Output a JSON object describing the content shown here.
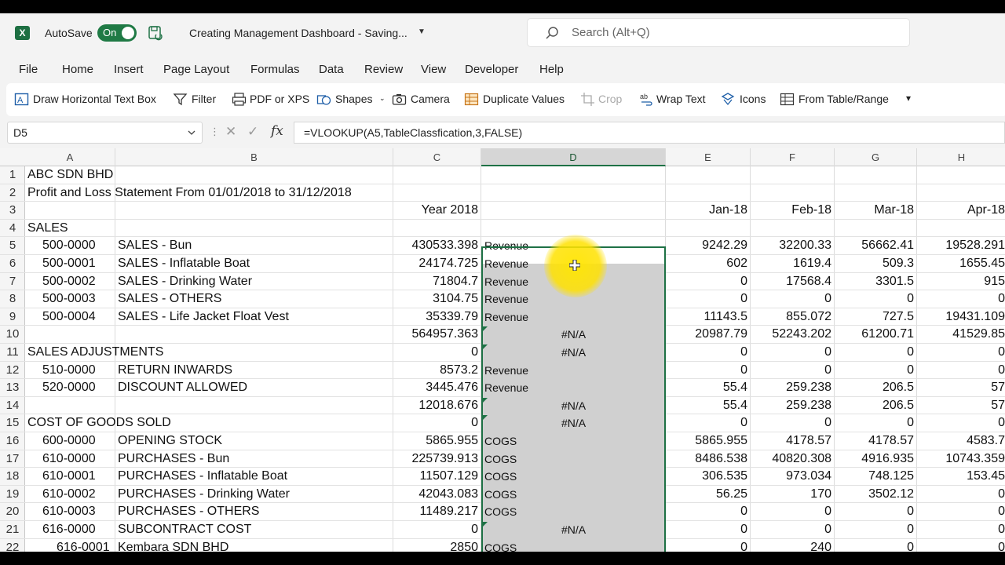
{
  "titlebar": {
    "autosave_label": "AutoSave",
    "toggle_state": "On",
    "document_title": "Creating Management Dashboard  -  Saving...",
    "search_placeholder": "Search (Alt+Q)"
  },
  "menu": [
    "File",
    "Home",
    "Insert",
    "Page Layout",
    "Formulas",
    "Data",
    "Review",
    "View",
    "Developer",
    "Help"
  ],
  "ribbon": {
    "draw_text_box": "Draw Horizontal Text Box",
    "filter": "Filter",
    "pdf": "PDF or XPS",
    "shapes": "Shapes",
    "camera": "Camera",
    "duplicate": "Duplicate Values",
    "crop": "Crop",
    "wrap": "Wrap Text",
    "icons": "Icons",
    "from_table": "From Table/Range"
  },
  "formula_bar": {
    "name_box": "D5",
    "formula": "=VLOOKUP(A5,TableClassfication,3,FALSE)"
  },
  "columns": [
    "A",
    "B",
    "C",
    "D",
    "E",
    "F",
    "G",
    "H"
  ],
  "rows": [
    {
      "n": "1",
      "a": "ABC SDN BHD",
      "b": "",
      "c": "",
      "d": "",
      "e": "",
      "f": "",
      "g": "",
      "h": ""
    },
    {
      "n": "2",
      "a": "Profit and Loss Statement From 01/01/2018 to 31/12/2018",
      "b": "",
      "c": "",
      "d": "",
      "e": "",
      "f": "",
      "g": "",
      "h": ""
    },
    {
      "n": "3",
      "a": "",
      "b": "",
      "c": "Year 2018",
      "d": "",
      "e": "Jan-18",
      "f": "Feb-18",
      "g": "Mar-18",
      "h": "Apr-18"
    },
    {
      "n": "4",
      "a": "SALES",
      "b": "",
      "c": "",
      "d": "",
      "e": "",
      "f": "",
      "g": "",
      "h": ""
    },
    {
      "n": "5",
      "a": "500-0000",
      "b": "SALES - Bun",
      "c": "430533.398",
      "d": "Revenue",
      "e": "9242.29",
      "f": "32200.33",
      "g": "56662.41",
      "h": "19528.291"
    },
    {
      "n": "6",
      "a": "500-0001",
      "b": "SALES - Inflatable Boat",
      "c": "24174.725",
      "d": "Revenue",
      "e": "602",
      "f": "1619.4",
      "g": "509.3",
      "h": "1655.45"
    },
    {
      "n": "7",
      "a": "500-0002",
      "b": "SALES - Drinking Water",
      "c": "71804.7",
      "d": "Revenue",
      "e": "0",
      "f": "17568.4",
      "g": "3301.5",
      "h": "915"
    },
    {
      "n": "8",
      "a": "500-0003",
      "b": "SALES - OTHERS",
      "c": "3104.75",
      "d": "Revenue",
      "e": "0",
      "f": "0",
      "g": "0",
      "h": "0"
    },
    {
      "n": "9",
      "a": "500-0004",
      "b": "SALES - Life Jacket Float Vest",
      "c": "35339.79",
      "d": "Revenue",
      "e": "11143.5",
      "f": "855.072",
      "g": "727.5",
      "h": "19431.109"
    },
    {
      "n": "10",
      "a": "",
      "b": "",
      "c": "564957.363",
      "d": "#N/A",
      "e": "20987.79",
      "f": "52243.202",
      "g": "61200.71",
      "h": "41529.85"
    },
    {
      "n": "11",
      "a": "SALES ADJUSTMENTS",
      "b": "",
      "c": "0",
      "d": "#N/A",
      "e": "0",
      "f": "0",
      "g": "0",
      "h": "0"
    },
    {
      "n": "12",
      "a": "510-0000",
      "b": "RETURN INWARDS",
      "c": "8573.2",
      "d": "Revenue",
      "e": "0",
      "f": "0",
      "g": "0",
      "h": "0"
    },
    {
      "n": "13",
      "a": "520-0000",
      "b": "DISCOUNT ALLOWED",
      "c": "3445.476",
      "d": "Revenue",
      "e": "55.4",
      "f": "259.238",
      "g": "206.5",
      "h": "57"
    },
    {
      "n": "14",
      "a": "",
      "b": "",
      "c": "12018.676",
      "d": "#N/A",
      "e": "55.4",
      "f": "259.238",
      "g": "206.5",
      "h": "57"
    },
    {
      "n": "15",
      "a": "COST OF GOODS SOLD",
      "b": "",
      "c": "0",
      "d": "#N/A",
      "e": "0",
      "f": "0",
      "g": "0",
      "h": "0"
    },
    {
      "n": "16",
      "a": "600-0000",
      "b": "OPENING STOCK",
      "c": "5865.955",
      "d": "COGS",
      "e": "5865.955",
      "f": "4178.57",
      "g": "4178.57",
      "h": "4583.7"
    },
    {
      "n": "17",
      "a": "610-0000",
      "b": "PURCHASES - Bun",
      "c": "225739.913",
      "d": "COGS",
      "e": "8486.538",
      "f": "40820.308",
      "g": "4916.935",
      "h": "10743.359"
    },
    {
      "n": "18",
      "a": "610-0001",
      "b": "PURCHASES - Inflatable Boat",
      "c": "11507.129",
      "d": "COGS",
      "e": "306.535",
      "f": "973.034",
      "g": "748.125",
      "h": "153.45"
    },
    {
      "n": "19",
      "a": "610-0002",
      "b": "PURCHASES - Drinking Water",
      "c": "42043.083",
      "d": "COGS",
      "e": "56.25",
      "f": "170",
      "g": "3502.12",
      "h": "0"
    },
    {
      "n": "20",
      "a": "610-0003",
      "b": "PURCHASES - OTHERS",
      "c": "11489.217",
      "d": "COGS",
      "e": "0",
      "f": "0",
      "g": "0",
      "h": "0"
    },
    {
      "n": "21",
      "a": "616-0000",
      "b": "SUBCONTRACT COST",
      "c": "0",
      "d": "#N/A",
      "e": "0",
      "f": "0",
      "g": "0",
      "h": "0"
    },
    {
      "n": "22",
      "a": "616-0001",
      "b": "Kembara SDN BHD",
      "c": "2850",
      "d": "COGS",
      "e": "0",
      "f": "240",
      "g": "0",
      "h": "0"
    }
  ],
  "colors": {
    "excel_green": "#1e7145",
    "selection_gray": "#d0d0d0",
    "cursor_highlight": "#ffe500"
  }
}
